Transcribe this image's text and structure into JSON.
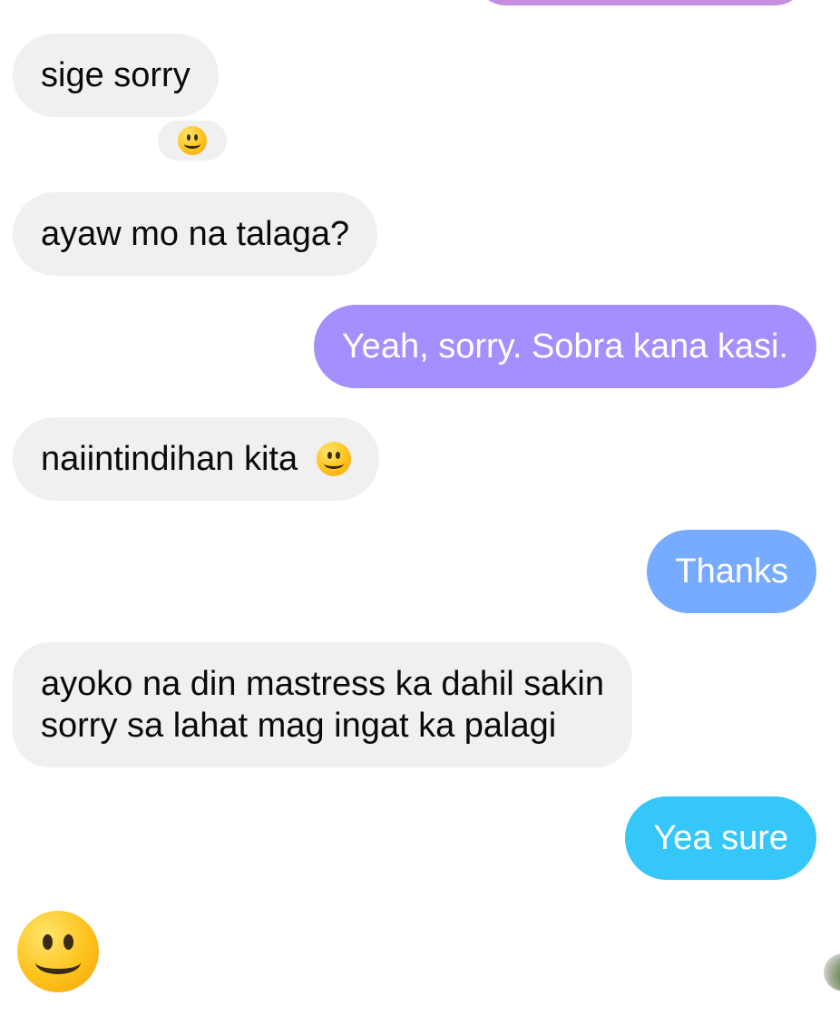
{
  "colors": {
    "incoming_bg": "#f0f0f0",
    "outgoing_purple": "#a58fff",
    "outgoing_blue": "#77abff",
    "outgoing_cyan": "#36c7fa"
  },
  "messages": [
    {
      "from": "them",
      "text": "sige sorry"
    },
    {
      "from": "them",
      "text": "ayaw mo na talaga?"
    },
    {
      "from": "me",
      "text": "Yeah, sorry. Sobra kana kasi."
    },
    {
      "from": "them",
      "text": "naiintindihan kita"
    },
    {
      "from": "me",
      "text": "Thanks"
    },
    {
      "from": "them",
      "line1": "ayoko na din mastress ka dahil sakin",
      "line2": "sorry sa lahat mag ingat ka palagi"
    },
    {
      "from": "me",
      "text": "Yea sure"
    }
  ],
  "icons": {
    "reaction": "slightly-smiling-face-icon",
    "inline_emoji": "slightly-smiling-face-icon",
    "big_emoji": "slightly-smiling-face-icon",
    "avatar": "avatar"
  }
}
